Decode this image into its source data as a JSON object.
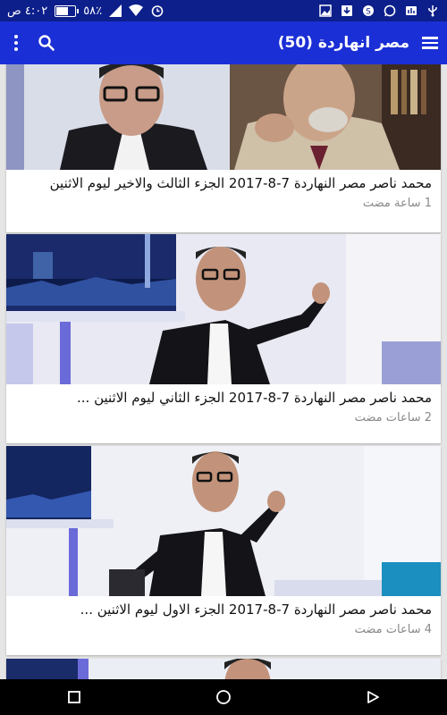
{
  "status_bar": {
    "time": "٤:٠٢ ص",
    "battery": "٥٨٪",
    "battery_level": 0.58,
    "left_icons": [
      "signal-icon",
      "wifi-icon",
      "alarm-icon"
    ],
    "right_icons": [
      "usb-icon",
      "notification-icon",
      "whatsapp-icon",
      "skype-icon",
      "download-icon",
      "gallery-icon"
    ]
  },
  "app_bar": {
    "title": "مصر انهاردة (50)",
    "colors": {
      "status": "#0d1f8a",
      "toolbar": "#1b2fd6"
    }
  },
  "feed": {
    "items": [
      {
        "title": "محمد ناصر مصر النهاردة 7-8-2017 الجزء الثالث والاخير ليوم الاثنين",
        "time": "1 ساعة مضت"
      },
      {
        "title": "محمد ناصر مصر النهاردة 7-8-2017 الجزء الثاني ليوم الاثنين ...",
        "time": "2 ساعات مضت"
      },
      {
        "title": "محمد ناصر مصر النهاردة 7-8-2017 الجزء الاول ليوم الاثنين ...",
        "time": "4 ساعات مضت"
      }
    ]
  },
  "nav_bar": {
    "buttons": [
      "recents-icon",
      "home-icon",
      "back-icon"
    ]
  }
}
